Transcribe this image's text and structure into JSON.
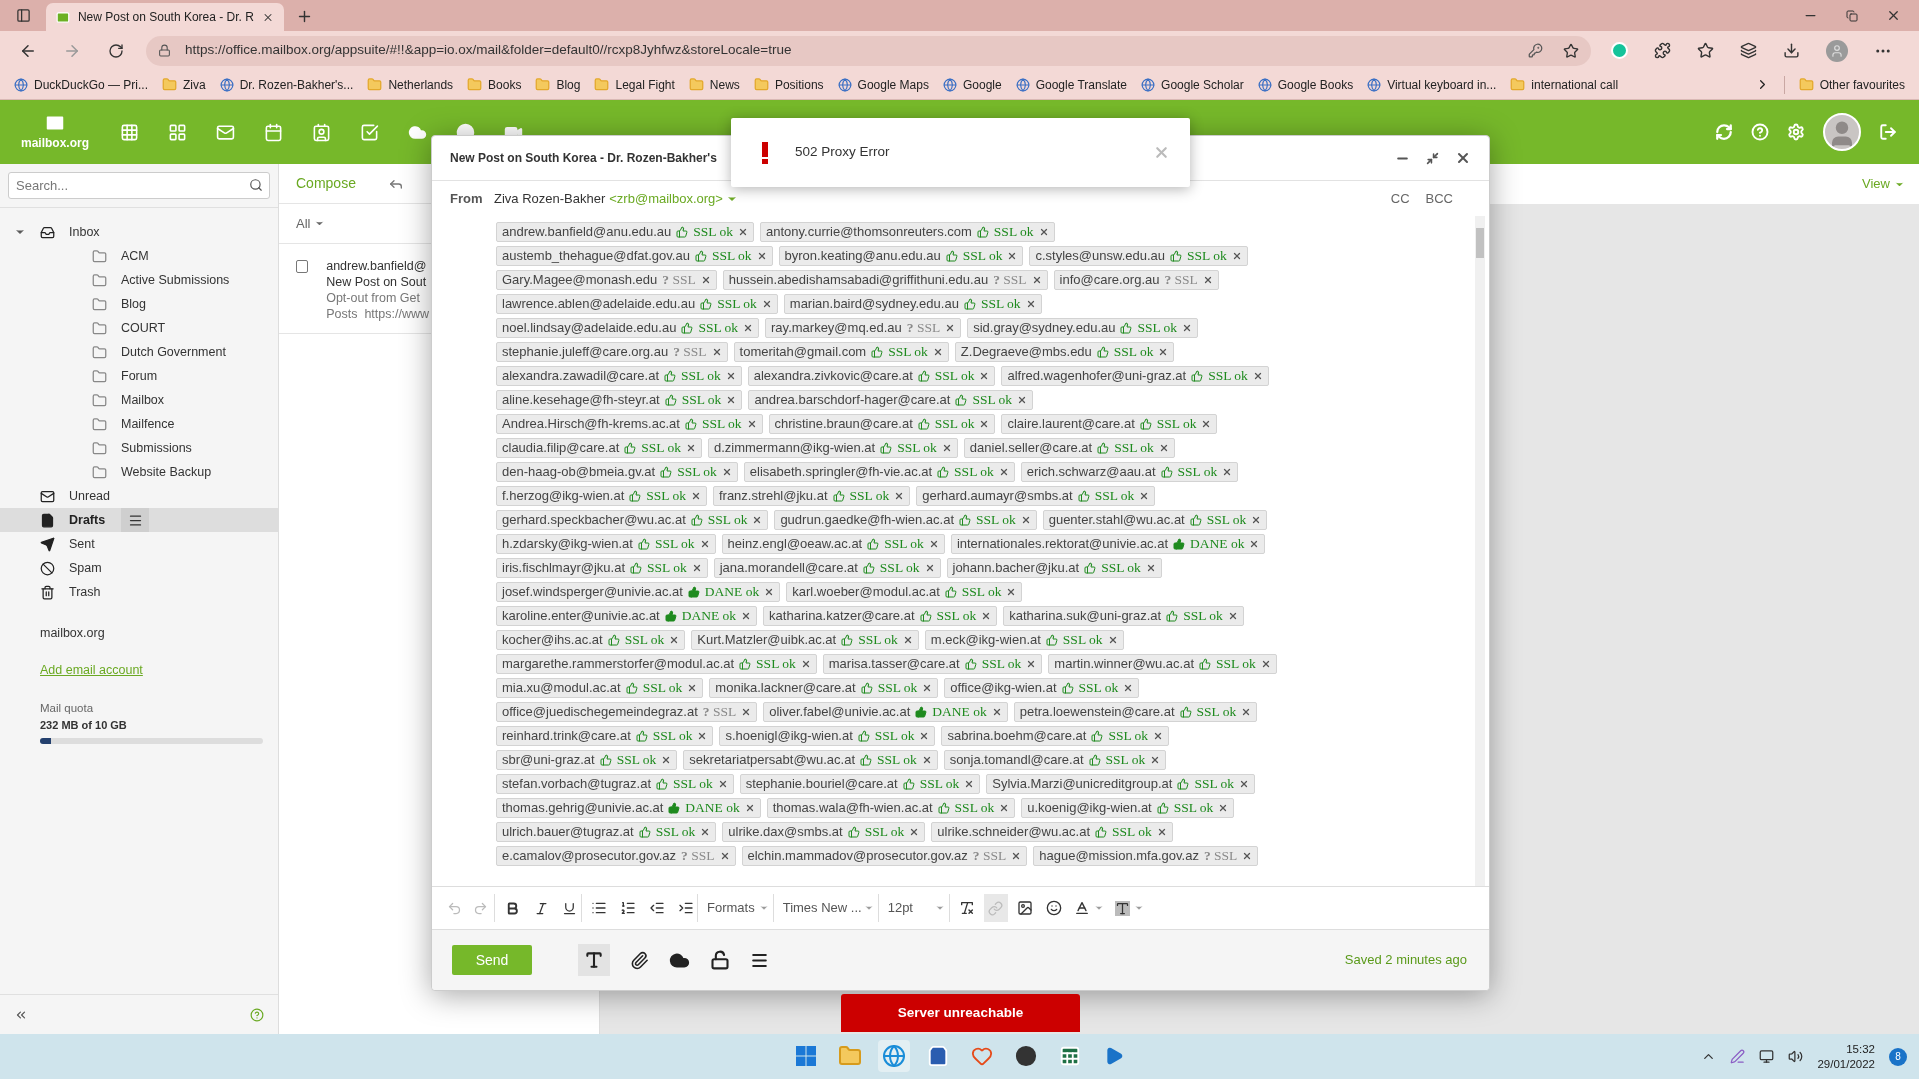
{
  "browser": {
    "tab_title": "New Post on South Korea - Dr. R",
    "url": "https://office.mailbox.org/appsuite/#!!&app=io.ox/mail&folder=default0//rcxp8Jyhfwz&storeLocale=true",
    "bookmarks": [
      {
        "label": "DuckDuckGo — Pri...",
        "kind": "site"
      },
      {
        "label": "Ziva",
        "kind": "folder"
      },
      {
        "label": "Dr. Rozen-Bakher's...",
        "kind": "site"
      },
      {
        "label": "Netherlands",
        "kind": "folder"
      },
      {
        "label": "Books",
        "kind": "folder"
      },
      {
        "label": "Blog",
        "kind": "folder"
      },
      {
        "label": "Legal Fight",
        "kind": "folder"
      },
      {
        "label": "News",
        "kind": "folder"
      },
      {
        "label": "Positions",
        "kind": "folder"
      },
      {
        "label": "Google Maps",
        "kind": "site"
      },
      {
        "label": "Google",
        "kind": "site"
      },
      {
        "label": "Google Translate",
        "kind": "site"
      },
      {
        "label": "Google Scholar",
        "kind": "site"
      },
      {
        "label": "Google Books",
        "kind": "site"
      },
      {
        "label": "Virtual keyboard in...",
        "kind": "site"
      },
      {
        "label": "international call",
        "kind": "folder"
      }
    ],
    "other_bookmarks": "Other favourites"
  },
  "app": {
    "logo": "mailbox.org"
  },
  "sidebar": {
    "search": {
      "placeholder": "Search..."
    },
    "folders": [
      {
        "label": "Inbox",
        "kind": "inbox",
        "expanded": true,
        "selected": false,
        "children": [
          {
            "label": "ACM",
            "kind": "folder",
            "selected": false
          },
          {
            "label": "Active Submissions",
            "kind": "folder",
            "selected": false
          },
          {
            "label": "Blog",
            "kind": "folder",
            "selected": false
          },
          {
            "label": "COURT",
            "kind": "folder",
            "selected": false
          },
          {
            "label": "Dutch Government",
            "kind": "folder",
            "selected": false
          },
          {
            "label": "Forum",
            "kind": "folder",
            "selected": false
          },
          {
            "label": "Mailbox",
            "kind": "folder",
            "selected": false
          },
          {
            "label": "Mailfence",
            "kind": "folder",
            "selected": false
          },
          {
            "label": "Submissions",
            "kind": "folder",
            "selected": false
          },
          {
            "label": "Website Backup",
            "kind": "folder",
            "selected": false
          }
        ]
      },
      {
        "label": "Unread",
        "kind": "unread",
        "selected": false
      },
      {
        "label": "Drafts",
        "kind": "drafts",
        "selected": true
      },
      {
        "label": "Sent",
        "kind": "sent",
        "selected": false
      },
      {
        "label": "Spam",
        "kind": "spam",
        "selected": false
      },
      {
        "label": "Trash",
        "kind": "trash",
        "selected": false
      }
    ],
    "account": "mailbox.org",
    "add_account": "Add email account",
    "quota": {
      "label": "Mail quota",
      "value": "232 MB of 10 GB",
      "level": 0.05
    }
  },
  "list": {
    "compose": "Compose",
    "filter": "All",
    "view": "View",
    "messages": [
      {
        "checked": false,
        "sender": "andrew.banfield@",
        "subject": "New Post on Sout",
        "preview": [
          "Opt-out from Get",
          "Posts  https://www"
        ]
      }
    ]
  },
  "compose": {
    "title": "New Post on South Korea - Dr. Rozen-Bakher's",
    "from_label": "From",
    "from_name": "Ziva Rozen-Bakher",
    "from_address": "<zrb@mailbox.org>",
    "cc": "CC",
    "bcc": "BCC",
    "recipient_rows": [
      [
        {
          "address": "andrew.banfield@anu.edu.au",
          "kind": "ssl_ok",
          "status": "SSL ok"
        },
        {
          "address": "antony.currie@thomsonreuters.com",
          "kind": "ssl_ok",
          "status": "SSL ok"
        }
      ],
      [
        {
          "address": "austemb_thehague@dfat.gov.au",
          "kind": "ssl_ok",
          "status": "SSL ok"
        },
        {
          "address": "byron.keating@anu.edu.au",
          "kind": "ssl_ok",
          "status": "SSL ok"
        },
        {
          "address": "c.styles@unsw.edu.au",
          "kind": "ssl_ok",
          "status": "SSL ok"
        }
      ],
      [
        {
          "address": "Gary.Magee@monash.edu",
          "kind": "ssl_unknown",
          "status": "**?** SSL"
        },
        {
          "address": "hussein.abedishamsabadi@griffithuni.edu.au",
          "kind": "ssl_unknown",
          "status": "**?** SSL"
        },
        {
          "address": "info@care.org.au",
          "kind": "ssl_unknown",
          "status": "**?** SSL"
        }
      ],
      [
        {
          "address": "lawrence.ablen@adelaide.edu.au",
          "kind": "ssl_ok",
          "status": "SSL ok"
        },
        {
          "address": "marian.baird@sydney.edu.au",
          "kind": "ssl_ok",
          "status": "SSL ok"
        }
      ],
      [
        {
          "address": "noel.lindsay@adelaide.edu.au",
          "kind": "ssl_ok",
          "status": "SSL ok"
        },
        {
          "address": "ray.markey@mq.ed.au",
          "kind": "ssl_unknown",
          "status": "**?** SSL"
        },
        {
          "address": "sid.gray@sydney.edu.au",
          "kind": "ssl_ok",
          "status": "SSL ok"
        }
      ],
      [
        {
          "address": "stephanie.juleff@care.org.au",
          "kind": "ssl_unknown",
          "status": "**?** SSL"
        },
        {
          "address": "tomeritah@gmail.com",
          "kind": "ssl_ok",
          "status": "SSL ok"
        },
        {
          "address": "Z.Degraeve@mbs.edu",
          "kind": "ssl_ok",
          "status": "SSL ok"
        }
      ],
      [
        {
          "address": "alexandra.zawadil@care.at",
          "kind": "ssl_ok",
          "status": "SSL ok"
        },
        {
          "address": "alexandra.zivkovic@care.at",
          "kind": "ssl_ok",
          "status": "SSL ok"
        },
        {
          "address": "alfred.wagenhofer@uni-graz.at",
          "kind": "ssl_ok",
          "status": "SSL ok"
        }
      ],
      [
        {
          "address": "aline.kesehage@fh-steyr.at",
          "kind": "ssl_ok",
          "status": "SSL ok"
        },
        {
          "address": "andrea.barschdorf-hager@care.at",
          "kind": "ssl_ok",
          "status": "SSL ok"
        }
      ],
      [
        {
          "address": "Andrea.Hirsch@fh-krems.ac.at",
          "kind": "ssl_ok",
          "status": "SSL ok"
        },
        {
          "address": "christine.braun@care.at",
          "kind": "ssl_ok",
          "status": "SSL ok"
        },
        {
          "address": "claire.laurent@care.at",
          "kind": "ssl_ok",
          "status": "SSL ok"
        }
      ],
      [
        {
          "address": "claudia.filip@care.at",
          "kind": "ssl_ok",
          "status": "SSL ok"
        },
        {
          "address": "d.zimmermann@ikg-wien.at",
          "kind": "ssl_ok",
          "status": "SSL ok"
        },
        {
          "address": "daniel.seller@care.at",
          "kind": "ssl_ok",
          "status": "SSL ok"
        }
      ],
      [
        {
          "address": "den-haag-ob@bmeia.gv.at",
          "kind": "ssl_ok",
          "status": "SSL ok"
        },
        {
          "address": "elisabeth.springler@fh-vie.ac.at",
          "kind": "ssl_ok",
          "status": "SSL ok"
        },
        {
          "address": "erich.schwarz@aau.at",
          "kind": "ssl_ok",
          "status": "SSL ok"
        }
      ],
      [
        {
          "address": "f.herzog@ikg-wien.at",
          "kind": "ssl_ok",
          "status": "SSL ok"
        },
        {
          "address": "franz.strehl@jku.at",
          "kind": "ssl_ok",
          "status": "SSL ok"
        },
        {
          "address": "gerhard.aumayr@smbs.at",
          "kind": "ssl_ok",
          "status": "SSL ok"
        }
      ],
      [
        {
          "address": "gerhard.speckbacher@wu.ac.at",
          "kind": "ssl_ok",
          "status": "SSL ok"
        },
        {
          "address": "gudrun.gaedke@fh-wien.ac.at",
          "kind": "ssl_ok",
          "status": "SSL ok"
        },
        {
          "address": "guenter.stahl@wu.ac.at",
          "kind": "ssl_ok",
          "status": "SSL ok"
        }
      ],
      [
        {
          "address": "h.zdarsky@ikg-wien.at",
          "kind": "ssl_ok",
          "status": "SSL ok"
        },
        {
          "address": "heinz.engl@oeaw.ac.at",
          "kind": "ssl_ok",
          "status": "SSL ok"
        },
        {
          "address": "internationales.rektorat@univie.ac.at",
          "kind": "dane_ok",
          "status": "DANE ok"
        }
      ],
      [
        {
          "address": "iris.fischlmayr@jku.at",
          "kind": "ssl_ok",
          "status": "SSL ok"
        },
        {
          "address": "jana.morandell@care.at",
          "kind": "ssl_ok",
          "status": "SSL ok"
        },
        {
          "address": "johann.bacher@jku.at",
          "kind": "ssl_ok",
          "status": "SSL ok"
        }
      ],
      [
        {
          "address": "josef.windsperger@univie.ac.at",
          "kind": "dane_ok",
          "status": "DANE ok"
        },
        {
          "address": "karl.woeber@modul.ac.at",
          "kind": "ssl_ok",
          "status": "SSL ok"
        }
      ],
      [
        {
          "address": "karoline.enter@univie.ac.at",
          "kind": "dane_ok",
          "status": "DANE ok"
        },
        {
          "address": "katharina.katzer@care.at",
          "kind": "ssl_ok",
          "status": "SSL ok"
        },
        {
          "address": "katharina.suk@uni-graz.at",
          "kind": "ssl_ok",
          "status": "SSL ok"
        }
      ],
      [
        {
          "address": "kocher@ihs.ac.at",
          "kind": "ssl_ok",
          "status": "SSL ok"
        },
        {
          "address": "Kurt.Matzler@uibk.ac.at",
          "kind": "ssl_ok",
          "status": "SSL ok"
        },
        {
          "address": "m.eck@ikg-wien.at",
          "kind": "ssl_ok",
          "status": "SSL ok"
        }
      ],
      [
        {
          "address": "margarethe.rammerstorfer@modul.ac.at",
          "kind": "ssl_ok",
          "status": "SSL ok"
        },
        {
          "address": "marisa.tasser@care.at",
          "kind": "ssl_ok",
          "status": "SSL ok"
        },
        {
          "address": "martin.winner@wu.ac.at",
          "kind": "ssl_ok",
          "status": "SSL ok"
        }
      ],
      [
        {
          "address": "mia.xu@modul.ac.at",
          "kind": "ssl_ok",
          "status": "SSL ok"
        },
        {
          "address": "monika.lackner@care.at",
          "kind": "ssl_ok",
          "status": "SSL ok"
        },
        {
          "address": "office@ikg-wien.at",
          "kind": "ssl_ok",
          "status": "SSL ok"
        }
      ],
      [
        {
          "address": "office@juedischegemeindegraz.at",
          "kind": "ssl_unknown",
          "status": "**?** SSL"
        },
        {
          "address": "oliver.fabel@univie.ac.at",
          "kind": "dane_ok",
          "status": "DANE ok"
        },
        {
          "address": "petra.loewenstein@care.at",
          "kind": "ssl_ok",
          "status": "SSL ok"
        }
      ],
      [
        {
          "address": "reinhard.trink@care.at",
          "kind": "ssl_ok",
          "status": "SSL ok"
        },
        {
          "address": "s.hoenigl@ikg-wien.at",
          "kind": "ssl_ok",
          "status": "SSL ok"
        },
        {
          "address": "sabrina.boehm@care.at",
          "kind": "ssl_ok",
          "status": "SSL ok"
        }
      ],
      [
        {
          "address": "sbr@uni-graz.at",
          "kind": "ssl_ok",
          "status": "SSL ok"
        },
        {
          "address": "sekretariatpersabt@wu.ac.at",
          "kind": "ssl_ok",
          "status": "SSL ok"
        },
        {
          "address": "sonja.tomandl@care.at",
          "kind": "ssl_ok",
          "status": "SSL ok"
        }
      ],
      [
        {
          "address": "stefan.vorbach@tugraz.at",
          "kind": "ssl_ok",
          "status": "SSL ok"
        },
        {
          "address": "stephanie.bouriel@care.at",
          "kind": "ssl_ok",
          "status": "SSL ok"
        },
        {
          "address": "Sylvia.Marzi@unicreditgroup.at",
          "kind": "ssl_ok",
          "status": "SSL ok"
        }
      ],
      [
        {
          "address": "thomas.gehrig@univie.ac.at",
          "kind": "dane_ok",
          "status": "DANE ok"
        },
        {
          "address": "thomas.wala@fh-wien.ac.at",
          "kind": "ssl_ok",
          "status": "SSL ok"
        },
        {
          "address": "u.koenig@ikg-wien.at",
          "kind": "ssl_ok",
          "status": "SSL ok"
        }
      ],
      [
        {
          "address": "ulrich.bauer@tugraz.at",
          "kind": "ssl_ok",
          "status": "SSL ok"
        },
        {
          "address": "ulrike.dax@smbs.at",
          "kind": "ssl_ok",
          "status": "SSL ok"
        },
        {
          "address": "ulrike.schneider@wu.ac.at",
          "kind": "ssl_ok",
          "status": "SSL ok"
        }
      ],
      [
        {
          "address": "e.camalov@prosecutor.gov.az",
          "kind": "ssl_unknown",
          "status": "**?** SSL"
        },
        {
          "address": "elchin.mammadov@prosecutor.gov.az",
          "kind": "ssl_unknown",
          "status": "**?** SSL"
        },
        {
          "address": "hague@mission.mfa.gov.az",
          "kind": "ssl_unknown",
          "status": "**?** SSL"
        }
      ]
    ],
    "toolbar": {
      "formats": "Formats",
      "font": "Times New ...",
      "size": "12pt"
    },
    "send": "Send",
    "saved": "Saved 2 minutes ago"
  },
  "error_popup": {
    "message": "502 Proxy Error"
  },
  "server_banner": "Server unreachable",
  "taskbar": {
    "time": "15:32",
    "date": "29/01/2022",
    "notifications": "8"
  }
}
